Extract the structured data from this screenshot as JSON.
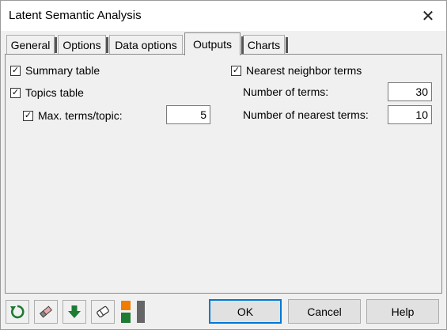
{
  "window": {
    "title": "Latent Semantic Analysis",
    "close_glyph": "✕"
  },
  "tabs": [
    {
      "label": "General",
      "active": false
    },
    {
      "label": "Options",
      "active": false
    },
    {
      "label": "Data options",
      "active": false
    },
    {
      "label": "Outputs",
      "active": true
    },
    {
      "label": "Charts",
      "active": false
    }
  ],
  "outputs": {
    "summary_table": {
      "label": "Summary table",
      "checked": true
    },
    "topics_table": {
      "label": "Topics table",
      "checked": true
    },
    "max_terms": {
      "label": "Max. terms/topic:",
      "checked": true,
      "value": "5"
    },
    "nearest_neighbor": {
      "label": "Nearest neighbor terms",
      "checked": true
    },
    "number_of_terms": {
      "label": "Number of terms:",
      "value": "30"
    },
    "number_of_nearest_terms": {
      "label": "Number of nearest terms:",
      "value": "10"
    }
  },
  "buttons": {
    "ok": "OK",
    "cancel": "Cancel",
    "help": "Help"
  },
  "toolbar_icons": [
    "reset-icon",
    "eraser-icon",
    "download-icon",
    "clear-selection-icon",
    "layout-toggle-icon"
  ],
  "colors": {
    "accent": "#0078d7",
    "green": "#1e7b34",
    "orange": "#f07c00"
  }
}
